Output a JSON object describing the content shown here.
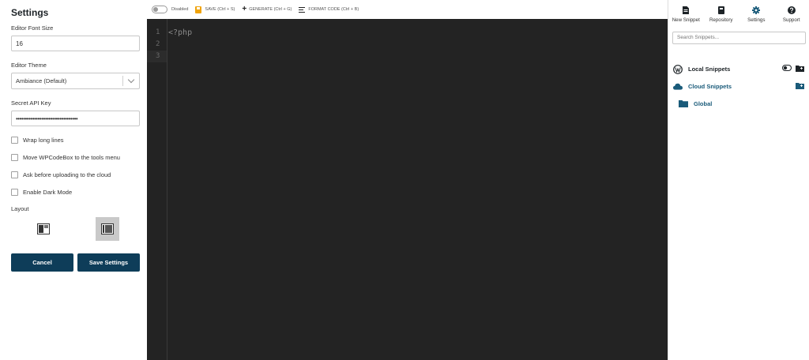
{
  "settings": {
    "title": "Settings",
    "font_size_label": "Editor Font Size",
    "font_size_value": "16",
    "theme_label": "Editor Theme",
    "theme_value": "Ambiance (Default)",
    "api_key_label": "Secret API Key",
    "api_key_value": "••••••••••••••••••••••••••••••••••",
    "checkboxes": [
      {
        "label": "Wrap long lines",
        "checked": false
      },
      {
        "label": "Move WPCodeBox to the tools menu",
        "checked": false
      },
      {
        "label": "Ask before uploading to the cloud",
        "checked": false
      },
      {
        "label": "Enable Dark Mode",
        "checked": false
      }
    ],
    "layout_label": "Layout",
    "cancel_label": "Cancel",
    "save_label": "Save Settings"
  },
  "toolbar": {
    "status": "Disabled",
    "save": "SAVE (Ctrl + S)",
    "generate": "GENERATE (Ctrl + G)",
    "format": "FORMAT CODE (Ctrl + B)"
  },
  "editor": {
    "line_numbers": [
      "1",
      "2",
      "3"
    ],
    "code_lines": [
      "<?php",
      "",
      ""
    ],
    "background": "#232323"
  },
  "sidebar": {
    "nav": [
      {
        "label": "New Snippet",
        "icon": "document-icon"
      },
      {
        "label": "Repository",
        "icon": "book-icon"
      },
      {
        "label": "Settings",
        "icon": "gear-icon"
      },
      {
        "label": "Support",
        "icon": "help-icon"
      }
    ],
    "search_placeholder": "Search Snippets...",
    "local_snippets": "Local Snippets",
    "cloud_snippets": "Cloud Snippets",
    "global_folder": "Global"
  },
  "colors": {
    "primary": "#0e3d59",
    "accent": "#1a5b7a",
    "save_icon": "#f0a30a"
  }
}
